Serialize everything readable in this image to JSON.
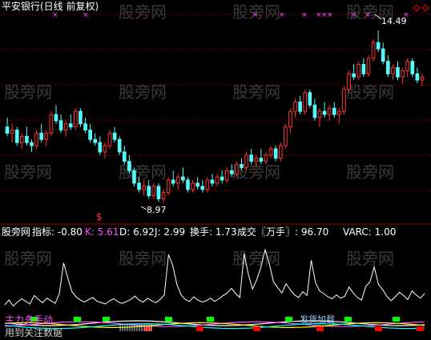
{
  "chart_title": "平安银行(日线 前复权)",
  "colors": {
    "up": "#ff3232",
    "down": "#54fcfc",
    "grid": "#7a0000",
    "magenta": "#ff50ff",
    "white": "#ffffff",
    "yellow": "#ffff00",
    "green": "#00ff00",
    "red": "#ff0000"
  },
  "price_chart": {
    "type": "candlestick",
    "grid": true,
    "high_label": "14.49",
    "low_label": "8.97",
    "marker_label": "$",
    "top_markers": [
      "×",
      "×",
      "×",
      "×",
      "×",
      "×",
      "×",
      "×",
      "×",
      "×",
      "×"
    ],
    "candles": [
      {
        "o": 11.4,
        "h": 11.7,
        "l": 11.1,
        "c": 11.2
      },
      {
        "o": 11.2,
        "h": 11.5,
        "l": 10.9,
        "c": 11.3
      },
      {
        "o": 11.3,
        "h": 11.4,
        "l": 10.8,
        "c": 10.9
      },
      {
        "o": 10.9,
        "h": 11.2,
        "l": 10.7,
        "c": 11.1
      },
      {
        "o": 11.1,
        "h": 11.4,
        "l": 10.8,
        "c": 10.9
      },
      {
        "o": 10.9,
        "h": 11.0,
        "l": 10.6,
        "c": 10.8
      },
      {
        "o": 10.8,
        "h": 11.3,
        "l": 10.7,
        "c": 11.2
      },
      {
        "o": 11.2,
        "h": 11.5,
        "l": 10.9,
        "c": 11.0
      },
      {
        "o": 11.0,
        "h": 11.3,
        "l": 10.8,
        "c": 11.2
      },
      {
        "o": 11.2,
        "h": 11.9,
        "l": 11.1,
        "c": 11.8
      },
      {
        "o": 11.8,
        "h": 12.1,
        "l": 11.5,
        "c": 11.6
      },
      {
        "o": 11.6,
        "h": 11.8,
        "l": 11.2,
        "c": 11.3
      },
      {
        "o": 11.3,
        "h": 11.6,
        "l": 11.1,
        "c": 11.5
      },
      {
        "o": 11.5,
        "h": 11.8,
        "l": 11.3,
        "c": 11.4
      },
      {
        "o": 11.4,
        "h": 12.0,
        "l": 11.3,
        "c": 11.9
      },
      {
        "o": 11.9,
        "h": 12.0,
        "l": 11.4,
        "c": 11.5
      },
      {
        "o": 11.5,
        "h": 11.7,
        "l": 11.2,
        "c": 11.3
      },
      {
        "o": 11.3,
        "h": 11.5,
        "l": 10.9,
        "c": 11.0
      },
      {
        "o": 11.0,
        "h": 11.2,
        "l": 10.8,
        "c": 10.9
      },
      {
        "o": 10.9,
        "h": 11.1,
        "l": 10.5,
        "c": 10.6
      },
      {
        "o": 10.6,
        "h": 10.9,
        "l": 10.4,
        "c": 10.8
      },
      {
        "o": 10.8,
        "h": 11.3,
        "l": 10.7,
        "c": 11.2
      },
      {
        "o": 11.2,
        "h": 11.4,
        "l": 10.9,
        "c": 11.0
      },
      {
        "o": 11.0,
        "h": 11.1,
        "l": 10.5,
        "c": 10.6
      },
      {
        "o": 10.6,
        "h": 10.8,
        "l": 10.2,
        "c": 10.3
      },
      {
        "o": 10.3,
        "h": 10.5,
        "l": 9.9,
        "c": 10.0
      },
      {
        "o": 10.0,
        "h": 10.1,
        "l": 9.5,
        "c": 9.6
      },
      {
        "o": 9.6,
        "h": 9.8,
        "l": 9.3,
        "c": 9.4
      },
      {
        "o": 9.4,
        "h": 9.7,
        "l": 9.2,
        "c": 9.5
      },
      {
        "o": 9.5,
        "h": 9.7,
        "l": 9.1,
        "c": 9.2
      },
      {
        "o": 9.2,
        "h": 9.6,
        "l": 9.1,
        "c": 9.5
      },
      {
        "o": 9.5,
        "h": 9.6,
        "l": 9.0,
        "c": 9.1
      },
      {
        "o": 9.1,
        "h": 9.4,
        "l": 8.97,
        "c": 9.3
      },
      {
        "o": 9.3,
        "h": 9.8,
        "l": 9.2,
        "c": 9.7
      },
      {
        "o": 9.7,
        "h": 10.0,
        "l": 9.5,
        "c": 9.6
      },
      {
        "o": 9.6,
        "h": 9.9,
        "l": 9.4,
        "c": 9.8
      },
      {
        "o": 9.8,
        "h": 10.1,
        "l": 9.6,
        "c": 9.7
      },
      {
        "o": 9.7,
        "h": 9.8,
        "l": 9.3,
        "c": 9.4
      },
      {
        "o": 9.4,
        "h": 9.7,
        "l": 9.3,
        "c": 9.6
      },
      {
        "o": 9.6,
        "h": 9.8,
        "l": 9.4,
        "c": 9.5
      },
      {
        "o": 9.5,
        "h": 9.7,
        "l": 9.3,
        "c": 9.4
      },
      {
        "o": 9.4,
        "h": 9.8,
        "l": 9.3,
        "c": 9.7
      },
      {
        "o": 9.7,
        "h": 9.9,
        "l": 9.5,
        "c": 9.6
      },
      {
        "o": 9.6,
        "h": 9.9,
        "l": 9.5,
        "c": 9.8
      },
      {
        "o": 9.8,
        "h": 10.0,
        "l": 9.6,
        "c": 9.7
      },
      {
        "o": 9.7,
        "h": 10.1,
        "l": 9.6,
        "c": 10.0
      },
      {
        "o": 10.0,
        "h": 10.2,
        "l": 9.8,
        "c": 9.9
      },
      {
        "o": 9.9,
        "h": 10.3,
        "l": 9.8,
        "c": 10.2
      },
      {
        "o": 10.2,
        "h": 10.4,
        "l": 10.0,
        "c": 10.1
      },
      {
        "o": 10.1,
        "h": 10.6,
        "l": 10.0,
        "c": 10.5
      },
      {
        "o": 10.5,
        "h": 10.7,
        "l": 10.2,
        "c": 10.3
      },
      {
        "o": 10.3,
        "h": 10.5,
        "l": 10.1,
        "c": 10.4
      },
      {
        "o": 10.4,
        "h": 10.7,
        "l": 10.2,
        "c": 10.3
      },
      {
        "o": 10.3,
        "h": 10.6,
        "l": 10.2,
        "c": 10.5
      },
      {
        "o": 10.5,
        "h": 10.8,
        "l": 10.4,
        "c": 10.7
      },
      {
        "o": 10.7,
        "h": 10.8,
        "l": 10.3,
        "c": 10.4
      },
      {
        "o": 10.4,
        "h": 10.9,
        "l": 10.3,
        "c": 10.8
      },
      {
        "o": 10.8,
        "h": 11.5,
        "l": 10.7,
        "c": 11.4
      },
      {
        "o": 11.4,
        "h": 12.0,
        "l": 11.2,
        "c": 11.9
      },
      {
        "o": 11.9,
        "h": 12.3,
        "l": 11.7,
        "c": 12.2
      },
      {
        "o": 12.2,
        "h": 12.4,
        "l": 11.8,
        "c": 11.9
      },
      {
        "o": 11.9,
        "h": 12.6,
        "l": 11.8,
        "c": 12.5
      },
      {
        "o": 12.5,
        "h": 12.6,
        "l": 12.0,
        "c": 12.1
      },
      {
        "o": 12.1,
        "h": 12.3,
        "l": 11.6,
        "c": 11.7
      },
      {
        "o": 11.7,
        "h": 12.0,
        "l": 11.4,
        "c": 11.9
      },
      {
        "o": 11.9,
        "h": 12.2,
        "l": 11.7,
        "c": 11.8
      },
      {
        "o": 11.8,
        "h": 12.1,
        "l": 11.6,
        "c": 12.0
      },
      {
        "o": 12.0,
        "h": 12.2,
        "l": 11.7,
        "c": 11.8
      },
      {
        "o": 11.8,
        "h": 12.0,
        "l": 11.5,
        "c": 11.9
      },
      {
        "o": 11.9,
        "h": 12.7,
        "l": 11.8,
        "c": 12.6
      },
      {
        "o": 12.6,
        "h": 13.2,
        "l": 12.5,
        "c": 13.1
      },
      {
        "o": 13.1,
        "h": 13.4,
        "l": 12.9,
        "c": 13.0
      },
      {
        "o": 13.0,
        "h": 13.5,
        "l": 12.9,
        "c": 13.4
      },
      {
        "o": 13.4,
        "h": 13.6,
        "l": 13.0,
        "c": 13.1
      },
      {
        "o": 13.1,
        "h": 13.7,
        "l": 13.0,
        "c": 13.6
      },
      {
        "o": 13.6,
        "h": 14.2,
        "l": 13.5,
        "c": 14.1
      },
      {
        "o": 14.1,
        "h": 14.49,
        "l": 13.8,
        "c": 13.9
      },
      {
        "o": 13.9,
        "h": 14.1,
        "l": 13.4,
        "c": 13.5
      },
      {
        "o": 13.5,
        "h": 13.7,
        "l": 13.0,
        "c": 13.1
      },
      {
        "o": 13.1,
        "h": 13.4,
        "l": 12.9,
        "c": 13.3
      },
      {
        "o": 13.3,
        "h": 13.5,
        "l": 12.9,
        "c": 13.0
      },
      {
        "o": 13.0,
        "h": 13.3,
        "l": 12.8,
        "c": 13.2
      },
      {
        "o": 13.2,
        "h": 13.6,
        "l": 13.0,
        "c": 13.5
      },
      {
        "o": 13.5,
        "h": 13.6,
        "l": 13.0,
        "c": 13.1
      },
      {
        "o": 13.1,
        "h": 13.3,
        "l": 12.8,
        "c": 12.9
      },
      {
        "o": 12.9,
        "h": 13.1,
        "l": 12.7,
        "c": 13.0
      }
    ],
    "ylim": [
      8.6,
      14.9
    ]
  },
  "indicator": {
    "label": "股旁网",
    "zhibiao": "指标: -0.80",
    "k": "K: 5.61",
    "d": "D: 6.92",
    "j": "J: 2.99",
    "huanshou": "换手: 1.73",
    "chengjiao": "成交〖万手〗: 96.70",
    "varc": "VARC: 1.00",
    "bottom_left_text": "主力多手动",
    "bottom_left_text2": "用到关注数据",
    "mid_text": "发货加载",
    "chart_data": {
      "type": "line",
      "series": [
        {
          "values": [
            2.1,
            2.8,
            1.9,
            2.5,
            3.0,
            2.6,
            2.2,
            3.5,
            2.9,
            2.4,
            3.1,
            2.7,
            2.3,
            3.8,
            8.5,
            6.2,
            4.1,
            3.3,
            2.8,
            2.5,
            2.9,
            3.2,
            2.6,
            2.4,
            2.2,
            2.7,
            3.0,
            2.5,
            2.3,
            2.6,
            2.9,
            3.4,
            2.8,
            2.5,
            3.1,
            2.7,
            2.4,
            2.9,
            3.6,
            9.8,
            8.1,
            5.2,
            3.6,
            2.9,
            2.6,
            3.3,
            2.8,
            2.5,
            2.7,
            3.1,
            2.6,
            3.0,
            3.5,
            3.9,
            4.6,
            3.8,
            3.2,
            9.9,
            6.8,
            4.5,
            5.9,
            7.8,
            10.5,
            8.4,
            5.6,
            4.7,
            3.9,
            5.3,
            4.4,
            3.6,
            3.2,
            4.1,
            3.5,
            8.9,
            5.5,
            4.2,
            3.8,
            3.3,
            3.0,
            3.6,
            3.1,
            3.4,
            4.8,
            3.9,
            3.2,
            2.8,
            4.9,
            5.6,
            7.9,
            5.2,
            4.4,
            3.4,
            2.7,
            3.3,
            4.0,
            3.5,
            2.9,
            4.2,
            3.6,
            3.1,
            3.8
          ]
        }
      ],
      "ylim": [
        0,
        12
      ]
    }
  },
  "watermark": "股旁网"
}
